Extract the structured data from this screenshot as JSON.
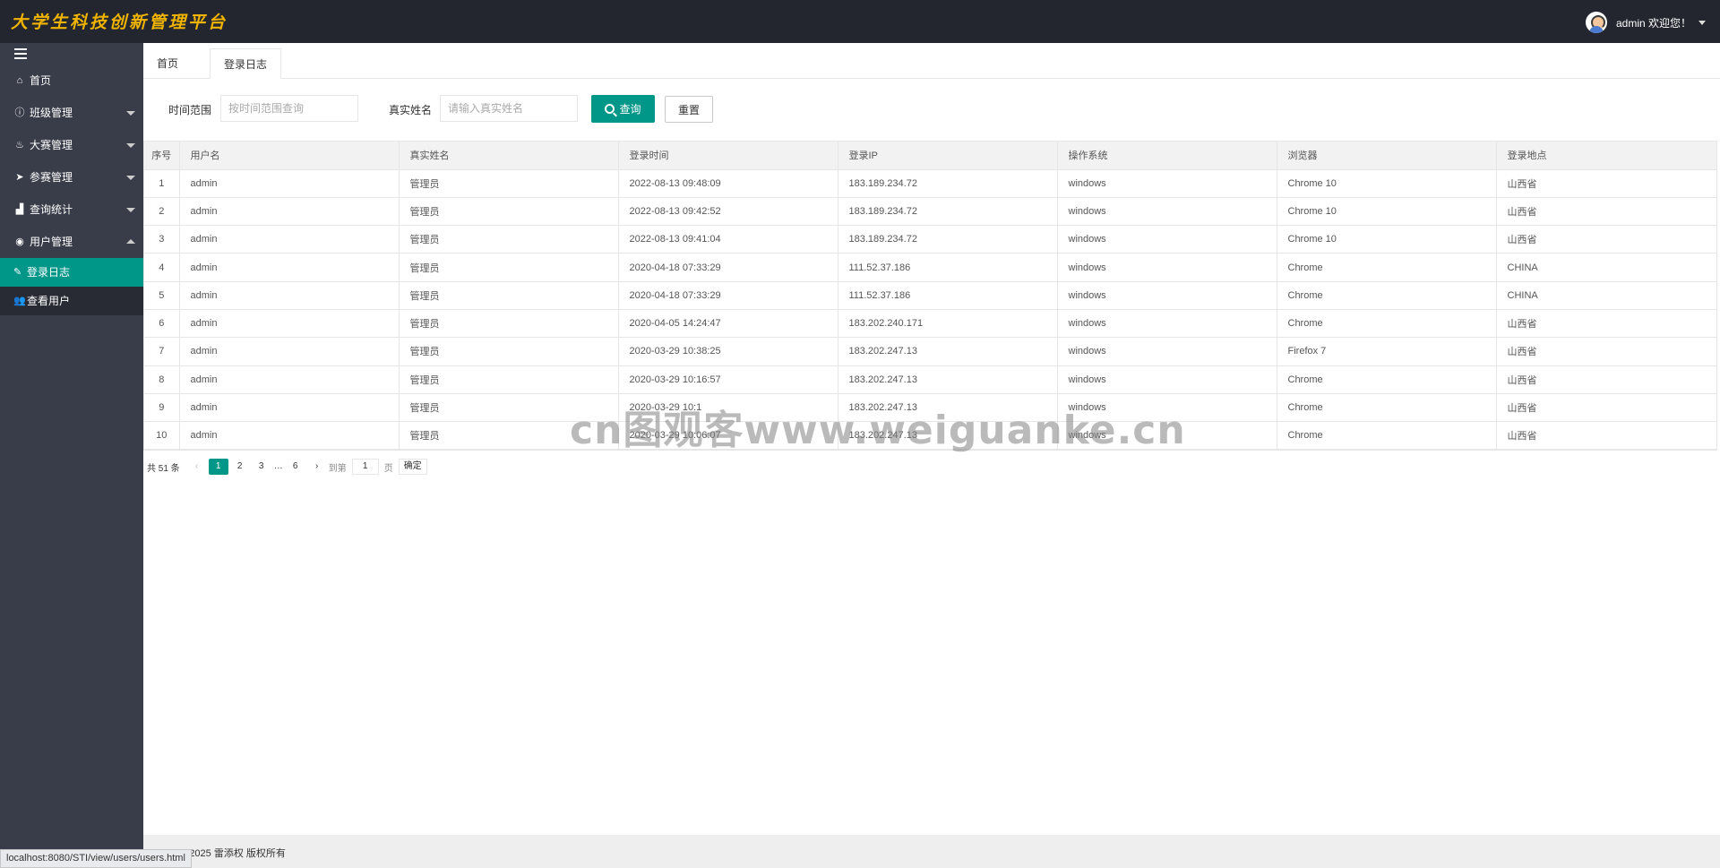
{
  "header": {
    "logo": "大学生科技创新管理平台",
    "user": "admin 欢迎您！"
  },
  "sidebar": {
    "items": [
      {
        "label": "首页",
        "icon": "home-icon"
      },
      {
        "label": "班级管理",
        "icon": "info-icon"
      },
      {
        "label": "大赛管理",
        "icon": "fire-icon"
      },
      {
        "label": "参赛管理",
        "icon": "paper-plane-icon"
      },
      {
        "label": "查询统计",
        "icon": "bar-chart-icon"
      },
      {
        "label": "用户管理",
        "icon": "user-circle-icon"
      }
    ],
    "sub_items": [
      {
        "label": "登录日志",
        "icon": "edit-icon"
      },
      {
        "label": "查看用户",
        "icon": "users-icon"
      }
    ]
  },
  "tabs": [
    "首页",
    "登录日志"
  ],
  "search": {
    "time_label": "时间范围",
    "time_placeholder": "按时间范围查询",
    "name_label": "真实姓名",
    "name_placeholder": "请输入真实姓名",
    "query_label": "查询",
    "reset_label": "重置"
  },
  "table": {
    "headers": [
      "序号",
      "用户名",
      "真实姓名",
      "登录时间",
      "登录IP",
      "操作系统",
      "浏览器",
      "登录地点"
    ],
    "rows": [
      [
        "1",
        "admin",
        "管理员",
        "2022-08-13 09:48:09",
        "183.189.234.72",
        "windows",
        "Chrome 10",
        "山西省"
      ],
      [
        "2",
        "admin",
        "管理员",
        "2022-08-13 09:42:52",
        "183.189.234.72",
        "windows",
        "Chrome 10",
        "山西省"
      ],
      [
        "3",
        "admin",
        "管理员",
        "2022-08-13 09:41:04",
        "183.189.234.72",
        "windows",
        "Chrome 10",
        "山西省"
      ],
      [
        "4",
        "admin",
        "管理员",
        "2020-04-18 07:33:29",
        "111.52.37.186",
        "windows",
        "Chrome",
        "CHINA"
      ],
      [
        "5",
        "admin",
        "管理员",
        "2020-04-18 07:33:29",
        "111.52.37.186",
        "windows",
        "Chrome",
        "CHINA"
      ],
      [
        "6",
        "admin",
        "管理员",
        "2020-04-05 14:24:47",
        "183.202.240.171",
        "windows",
        "Chrome",
        "山西省"
      ],
      [
        "7",
        "admin",
        "管理员",
        "2020-03-29 10:38:25",
        "183.202.247.13",
        "windows",
        "Firefox 7",
        "山西省"
      ],
      [
        "8",
        "admin",
        "管理员",
        "2020-03-29 10:16:57",
        "183.202.247.13",
        "windows",
        "Chrome",
        "山西省"
      ],
      [
        "9",
        "admin",
        "管理员",
        "2020-03-29 10:1",
        "183.202.247.13",
        "windows",
        "Chrome",
        "山西省"
      ],
      [
        "10",
        "admin",
        "管理员",
        "2020-03-29 10:06:07",
        "183.202.247.13",
        "windows",
        "Chrome",
        "山西省"
      ]
    ]
  },
  "pager": {
    "total": "共 51 条",
    "pages": [
      "1",
      "2",
      "3",
      "…",
      "6"
    ],
    "goto_label": "到第",
    "goto_value": "1",
    "page_unit": "页",
    "confirm": "确定"
  },
  "footer": {
    "copyright": "© 2019-2025 雷添权 版权所有"
  },
  "statusbar": {
    "url": "localhost:8080/STI/view/users/users.html"
  },
  "watermark": "cn图观客www.weiguanke.cn",
  "colors": {
    "accent": "#009688",
    "header_bg": "#23262e",
    "sidebar_bg": "#393d49",
    "logo": "#f0b400"
  }
}
